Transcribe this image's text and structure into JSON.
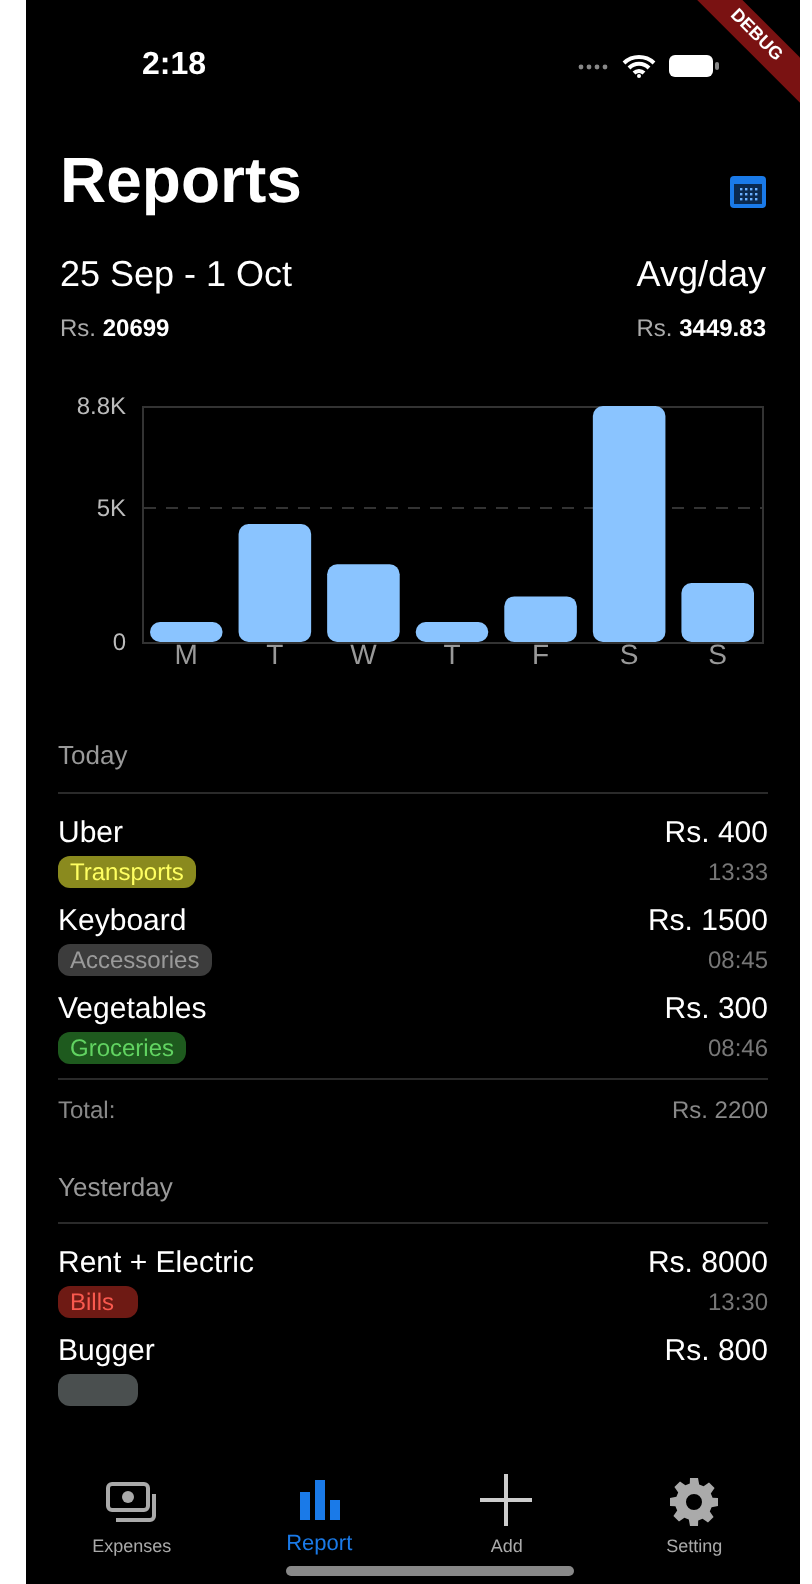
{
  "status_bar": {
    "time": "2:18"
  },
  "debug_banner": "DEBUG",
  "header": {
    "title": "Reports",
    "range": "25 Sep - 1 Oct",
    "total_prefix": "Rs.",
    "total": "20699",
    "avg_label": "Avg/day",
    "avg_prefix": "Rs.",
    "avg": "3449.83"
  },
  "chart_data": {
    "type": "bar",
    "categories": [
      "M",
      "T",
      "W",
      "T",
      "F",
      "S",
      "S"
    ],
    "series": [
      {
        "color": "#8ac4ff",
        "values": [
          700,
          4400,
          2900,
          700,
          1700,
          8800,
          2200
        ]
      }
    ],
    "ylim": [
      0,
      8800
    ],
    "yticks": [
      {
        "value": 0,
        "label": "0"
      },
      {
        "value": 5000,
        "label": "5K"
      },
      {
        "value": 8800,
        "label": "8.8K"
      }
    ]
  },
  "sections": [
    {
      "title": "Today",
      "items": [
        {
          "name": "Uber",
          "amount": "Rs. 400",
          "category": "Transports",
          "color": "#8a8a1e",
          "time": "13:33"
        },
        {
          "name": "Keyboard",
          "amount": "Rs. 1500",
          "category": "Accessories",
          "color": "#3c3c3c",
          "time": "08:45"
        },
        {
          "name": "Vegetables",
          "amount": "Rs. 300",
          "category": "Groceries",
          "color": "#1e5a1e",
          "time": "08:46"
        }
      ],
      "total_label": "Total:",
      "total": "Rs. 2200"
    },
    {
      "title": "Yesterday",
      "items": [
        {
          "name": "Rent + Electric",
          "amount": "Rs. 8000",
          "category": "Bills",
          "color": "#6e1a14",
          "time": "13:30"
        },
        {
          "name": "Bugger",
          "amount": "Rs. 800",
          "color": "#4a4f4f"
        }
      ]
    }
  ],
  "tabs": [
    {
      "label": "Expenses",
      "kind": "expenses",
      "selected": false
    },
    {
      "label": "Report",
      "kind": "report",
      "selected": true
    },
    {
      "label": "Add",
      "kind": "add",
      "selected": false
    },
    {
      "label": "Setting",
      "kind": "setting",
      "selected": false
    }
  ]
}
